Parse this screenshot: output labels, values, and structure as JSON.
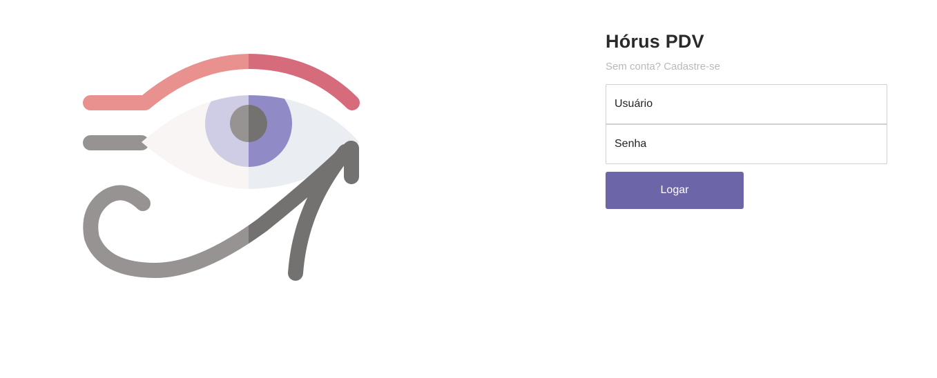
{
  "brand": {
    "logo_icon": "eye-of-horus-icon",
    "title": "Hórus PDV",
    "signup_link": "Sem conta? Cadastre-se"
  },
  "form": {
    "username_placeholder": "Usuário",
    "password_placeholder": "Senha",
    "submit_label": "Logar"
  },
  "colors": {
    "primary": "#6c66a8",
    "brow_light": "#e8918f",
    "brow_dark": "#d56b7b",
    "gray_light": "#969392",
    "gray_dark": "#747271",
    "iris_light": "#cfcde6",
    "iris_dark": "#908bc6"
  }
}
